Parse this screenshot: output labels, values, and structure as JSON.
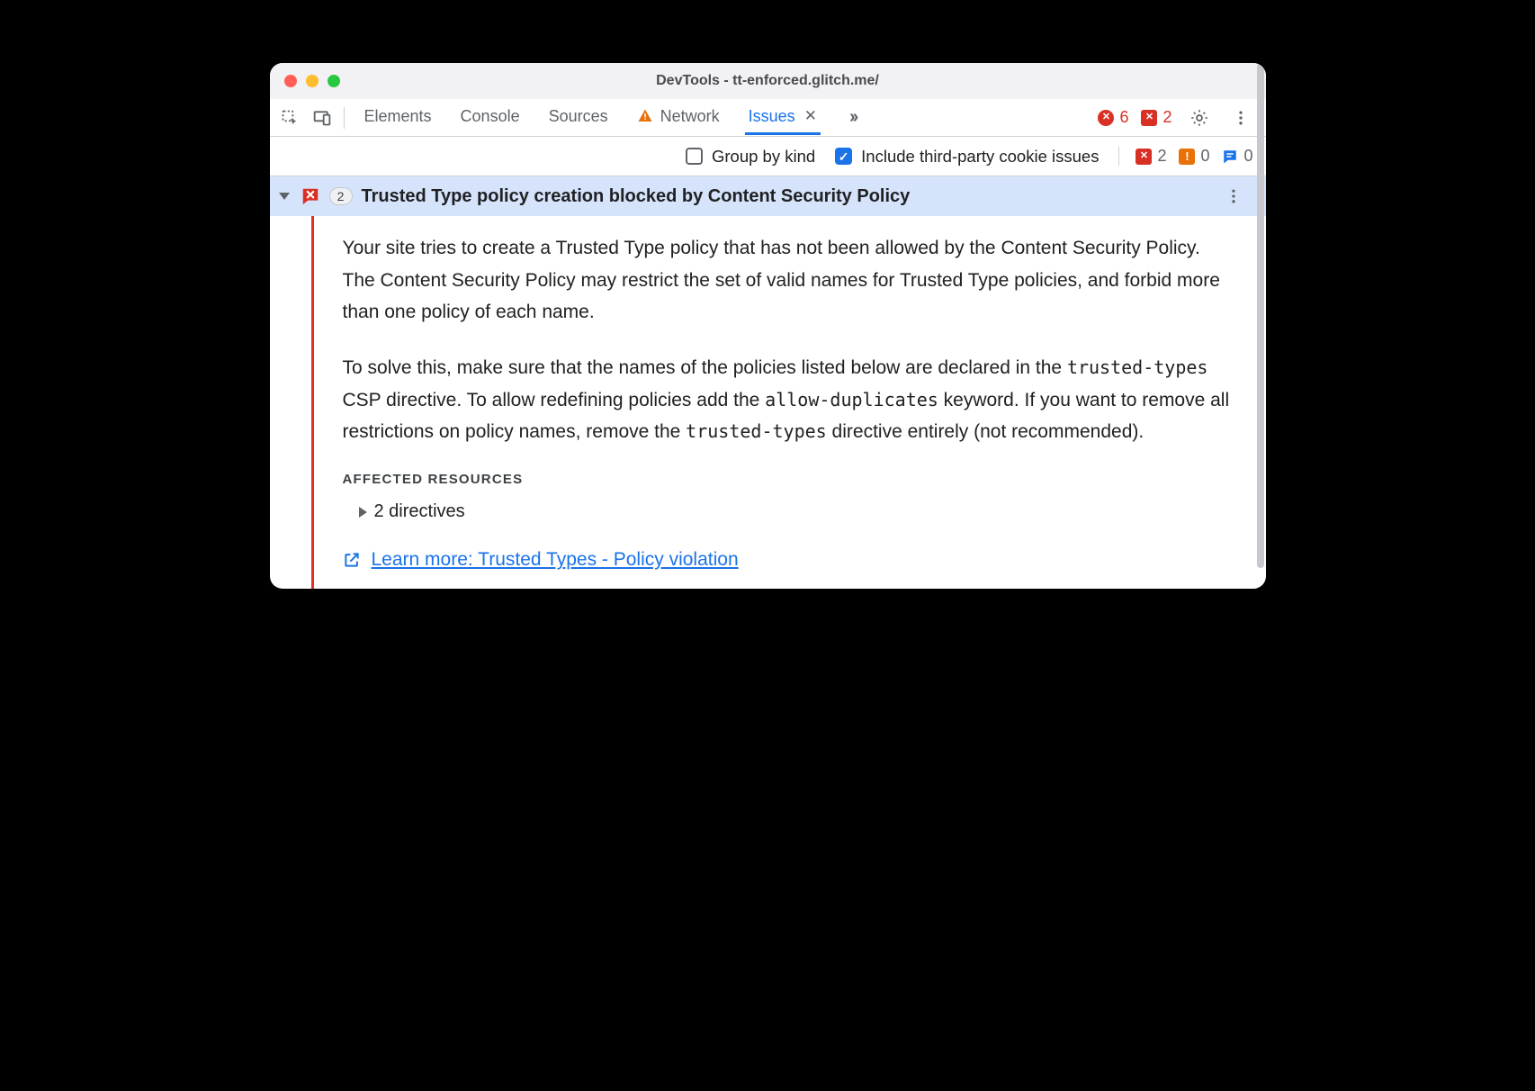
{
  "window": {
    "title": "DevTools - tt-enforced.glitch.me/"
  },
  "toolbar": {
    "tabs": {
      "elements": "Elements",
      "console": "Console",
      "sources": "Sources",
      "network": "Network",
      "issues": "Issues"
    },
    "errors_count": "6",
    "issues_count": "2"
  },
  "filterbar": {
    "group_by_kind": "Group by kind",
    "include_third_party": "Include third-party cookie issues",
    "counts": {
      "errors": "2",
      "warnings": "0",
      "info": "0"
    }
  },
  "issue": {
    "count": "2",
    "title": "Trusted Type policy creation blocked by Content Security Policy",
    "para1": "Your site tries to create a Trusted Type policy that has not been allowed by the Content Security Policy. The Content Security Policy may restrict the set of valid names for Trusted Type policies, and forbid more than one policy of each name.",
    "para2_a": "To solve this, make sure that the names of the policies listed below are declared in the ",
    "code1": "trusted-types",
    "para2_b": " CSP directive. To allow redefining policies add the ",
    "code2": "allow-duplicates",
    "para2_c": " keyword. If you want to remove all restrictions on policy names, remove the ",
    "code3": "trusted-types",
    "para2_d": " directive entirely (not recommended).",
    "affected_label": "Affected Resources",
    "directives": "2 directives",
    "learn_more": "Learn more: Trusted Types - Policy violation"
  }
}
